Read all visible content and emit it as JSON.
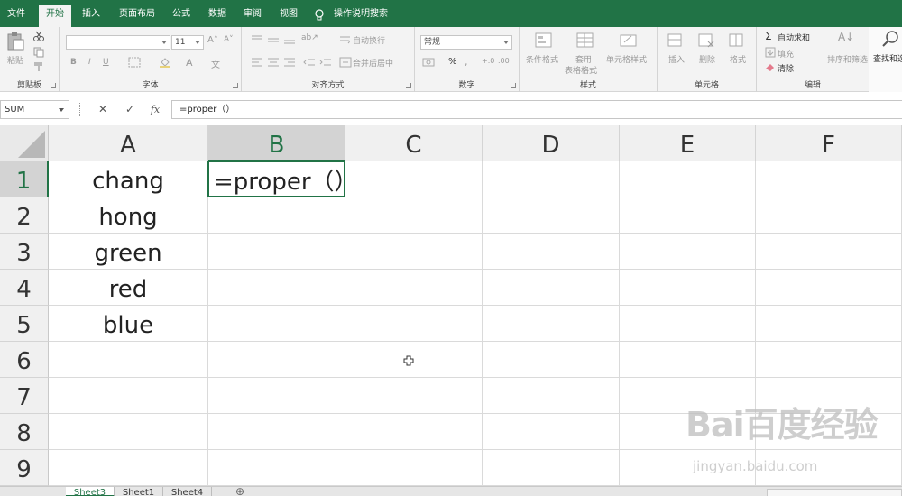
{
  "tabs": [
    {
      "label": "文件",
      "active": false
    },
    {
      "label": "开始",
      "active": true
    },
    {
      "label": "插入",
      "active": false
    },
    {
      "label": "页面布局",
      "active": false
    },
    {
      "label": "公式",
      "active": false
    },
    {
      "label": "数据",
      "active": false
    },
    {
      "label": "审阅",
      "active": false
    },
    {
      "label": "视图",
      "active": false
    }
  ],
  "search": {
    "label": "操作说明搜索",
    "icon": "lightbulb-icon"
  },
  "ribbon": {
    "clipboard": {
      "label": "剪贴板",
      "paste": "粘贴"
    },
    "font": {
      "label": "字体",
      "name": "",
      "size": "11",
      "bold": "B",
      "italic": "I",
      "underline": "U"
    },
    "alignment": {
      "label": "对齐方式",
      "wrap": "自动换行",
      "merge": "合并后居中"
    },
    "number": {
      "label": "数字",
      "format": "常规",
      "percent": "%"
    },
    "styles": {
      "label": "样式",
      "conditional": "条件格式",
      "table1": "套用",
      "table2": "表格格式",
      "cell_styles": "单元格样式"
    },
    "cells": {
      "label": "单元格",
      "insert": "插入",
      "delete": "删除",
      "format": "格式"
    },
    "editing": {
      "label": "编辑",
      "autosum": "自动求和",
      "fill": "填充",
      "clear": "清除",
      "sort": "排序和筛选",
      "find": "查找和选"
    }
  },
  "formula_bar": {
    "name_box": "SUM",
    "cancel": "✕",
    "enter": "✓",
    "fx": "fx",
    "formula": "=proper（）"
  },
  "columns": [
    "A",
    "B",
    "C",
    "D",
    "E",
    "F"
  ],
  "rows": [
    "1",
    "2",
    "3",
    "4",
    "5",
    "6",
    "7",
    "8",
    "9"
  ],
  "cells": {
    "A1": "chang",
    "A2": "hong",
    "A3": "green",
    "A4": "red",
    "A5": "blue",
    "B1": "=proper（）"
  },
  "active_cell": "B1",
  "sheets": [
    {
      "label": "Sheet3",
      "active": true
    },
    {
      "label": "Sheet1",
      "active": false
    },
    {
      "label": "Sheet4",
      "active": false
    }
  ],
  "add_sheet": "⊕",
  "watermark": {
    "logo": "Bai百度经验",
    "url": "jingyan.baidu.com"
  },
  "colors": {
    "accent": "#217346",
    "grid": "#dadada",
    "header_bg": "#f0f0f0"
  }
}
